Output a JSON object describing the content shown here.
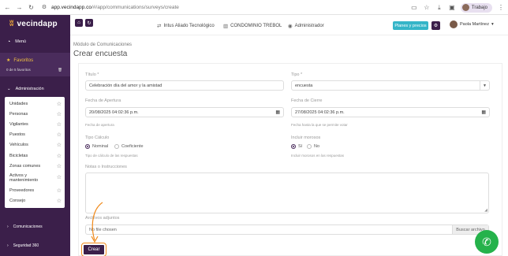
{
  "browser": {
    "url_host": "app.vecindapp.co",
    "url_path": "/#/app/communications/surveys/create",
    "profile_label": "Trabajo"
  },
  "sidebar": {
    "logo_text": "vecindapp",
    "menu_label": "Menú",
    "favorites_title": "Favoritos",
    "favorites_count": "0 de 5 favoritos",
    "admin_label": "Administración",
    "admin_items": [
      {
        "label": "Unidades"
      },
      {
        "label": "Personas"
      },
      {
        "label": "Vigilantes"
      },
      {
        "label": "Puestos"
      },
      {
        "label": "Vehículos"
      },
      {
        "label": "Bicicletas"
      },
      {
        "label": "Zonas comunes"
      },
      {
        "label": "Activos y mantenimiento"
      },
      {
        "label": "Proveedores"
      },
      {
        "label": "Consejo"
      }
    ],
    "communications_label": "Comunicaciones",
    "security_label": "Seguridad 360"
  },
  "header": {
    "ally": "Intus Aliado Tecnológico",
    "condo": "CONDOMINIO TREBOL",
    "role": "Administrador",
    "plans_button": "Planes y precios",
    "user_name": "Paola Martínez"
  },
  "page": {
    "breadcrumb": "Módulo de Comunicaciones",
    "title": "Crear encuesta"
  },
  "form": {
    "title_label": "Título *",
    "title_value": "Celebración día del amor y la amistad",
    "type_label": "Tipo *",
    "type_value": "encuesta",
    "open_date_label": "Fecha de Apertura",
    "open_date_value": "20/08/2025 04:02:36 p.m.",
    "open_date_help": "Fecha de apertura",
    "close_date_label": "Fecha de Cierre",
    "close_date_value": "27/08/2025 04:02:36 p.m.",
    "close_date_help": "Fecha hasta la que se permite votar",
    "calc_label": "Tipo Cálculo",
    "calc_options": [
      "Nominal",
      "Coeficiente"
    ],
    "calc_selected": "Nominal",
    "calc_help": "Tipo de cálculo de las respuestas",
    "debtors_label": "Incluir morosos",
    "debtors_options": [
      "Sí",
      "No"
    ],
    "debtors_selected": "Sí",
    "debtors_help": "Incluir morosos en las respuestas",
    "notes_label": "Notas o Instrucciones",
    "attachments_label": "Archivos adjuntos",
    "file_placeholder": "No file chosen",
    "file_button": "Buscar archivo",
    "submit_label": "Crear"
  },
  "colors": {
    "sidebar_bg": "#3b1f4a",
    "accent": "#35b5c8",
    "highlight": "#f08a1c",
    "whatsapp": "#25b24b"
  }
}
